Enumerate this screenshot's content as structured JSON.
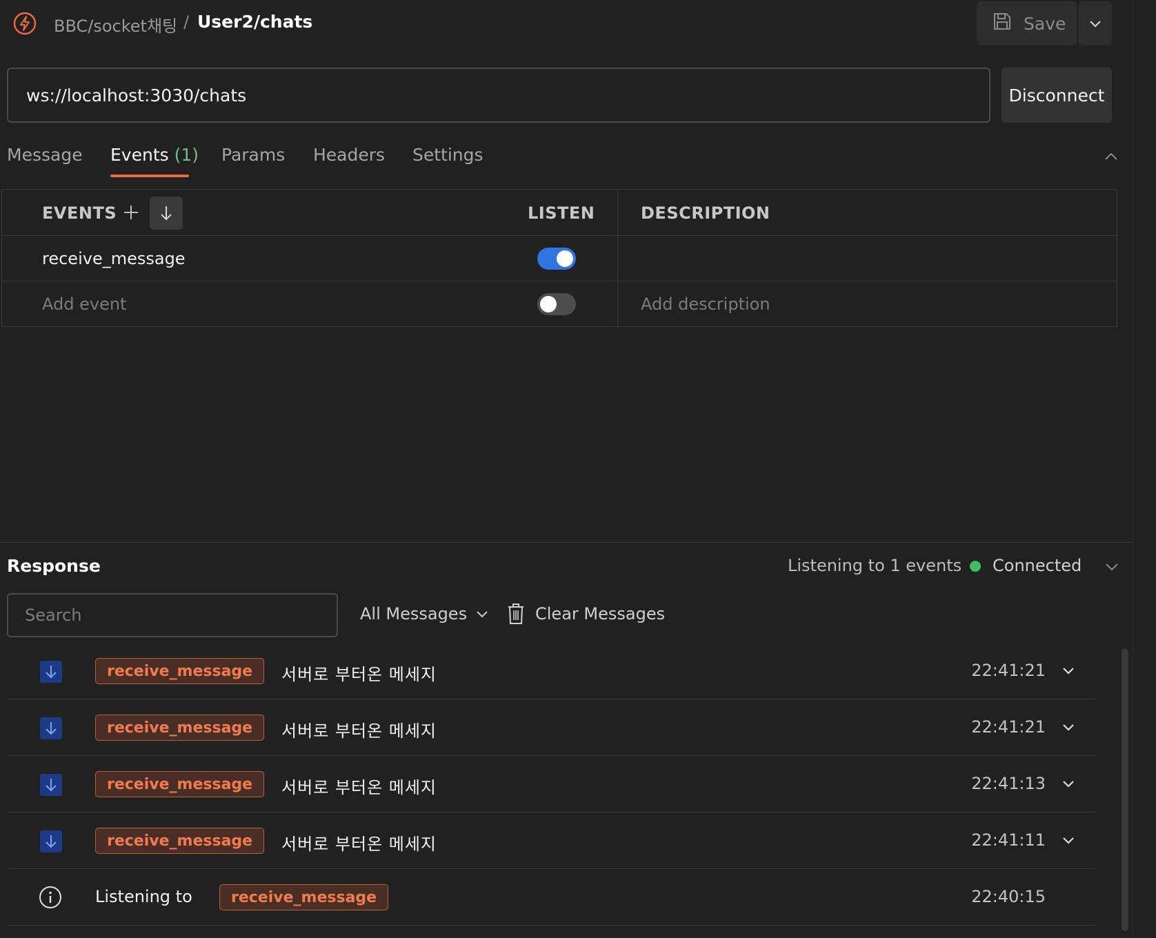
{
  "header": {
    "breadcrumb_parent": "BBC/socket채팅",
    "breadcrumb_sep": "/",
    "breadcrumb_current": "User2/chats",
    "save_label": "Save",
    "logo_icon": "postman-socket-icon"
  },
  "request": {
    "url": "ws://localhost:3030/chats",
    "disconnect_label": "Disconnect"
  },
  "tabs": [
    {
      "label": "Message",
      "active": false
    },
    {
      "label": "Events",
      "count": "(1)",
      "active": true
    },
    {
      "label": "Params",
      "active": false
    },
    {
      "label": "Headers",
      "active": false
    },
    {
      "label": "Settings",
      "active": false
    }
  ],
  "events_table": {
    "headers": {
      "events": "EVENTS",
      "listen": "LISTEN",
      "description": "DESCRIPTION"
    },
    "rows": [
      {
        "name": "receive_message",
        "listen": true,
        "description": ""
      }
    ],
    "new_row": {
      "name_placeholder": "Add event",
      "listen": false,
      "description_placeholder": "Add description"
    }
  },
  "response": {
    "title": "Response",
    "listening_count": "Listening to 1 events",
    "status": "Connected",
    "status_color": "#3ebd62",
    "search_placeholder": "Search",
    "filter_label": "All Messages",
    "clear_label": "Clear Messages",
    "messages": [
      {
        "event": "receive_message",
        "text": "서버로 부터온 메세지",
        "time": "22:41:21"
      },
      {
        "event": "receive_message",
        "text": "서버로 부터온 메세지",
        "time": "22:41:21"
      },
      {
        "event": "receive_message",
        "text": "서버로 부터온 메세지",
        "time": "22:41:13"
      },
      {
        "event": "receive_message",
        "text": "서버로 부터온 메세지",
        "time": "22:41:11"
      }
    ],
    "info_row": {
      "label": "Listening to",
      "event": "receive_message",
      "time": "22:40:15"
    }
  },
  "colors": {
    "accent": "#ec6a3e",
    "toggle_on": "#2f74e0",
    "tag_text": "#f07b4e",
    "incoming_icon_bg": "#1f3a84"
  }
}
